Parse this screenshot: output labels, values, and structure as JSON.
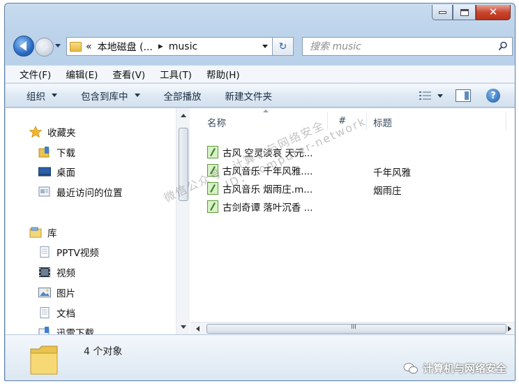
{
  "window": {
    "address": {
      "prefix": "«",
      "parts": [
        "本地磁盘 (...",
        "music"
      ]
    },
    "search": {
      "placeholder": "搜索 music"
    }
  },
  "menubar": [
    "文件(F)",
    "编辑(E)",
    "查看(V)",
    "工具(T)",
    "帮助(H)"
  ],
  "commandbar": {
    "organize": "组织",
    "include": "包含到库中",
    "play_all": "全部播放",
    "new_folder": "新建文件夹"
  },
  "nav": {
    "favorites": "收藏夹",
    "fav_items": [
      "下载",
      "桌面",
      "最近访问的位置"
    ],
    "libraries": "库",
    "lib_items": [
      "PPTV视频",
      "视频",
      "图片",
      "文档",
      "迅雷下载"
    ]
  },
  "columns": {
    "name": "名称",
    "number": "#",
    "title": "标题"
  },
  "files": [
    {
      "name": "古风 空灵淡哀 天元...",
      "number": "",
      "title": ""
    },
    {
      "name": "古风音乐 千年风雅....",
      "number": "",
      "title": "千年风雅"
    },
    {
      "name": "古风音乐 烟雨庄.m...",
      "number": "",
      "title": "烟雨庄"
    },
    {
      "name": "古剑奇谭 落叶沉香 ...",
      "number": "",
      "title": ""
    }
  ],
  "scrollbar_grip": "III",
  "status": {
    "count": "4 个对象"
  },
  "watermark": {
    "line1": "微信公众号：计算机与网络安全",
    "line2": "ID：Computer-network",
    "corner": "计算机与网络安全"
  },
  "colors": {
    "close_button": "#c9462f",
    "accent": "#2b6cc4"
  }
}
